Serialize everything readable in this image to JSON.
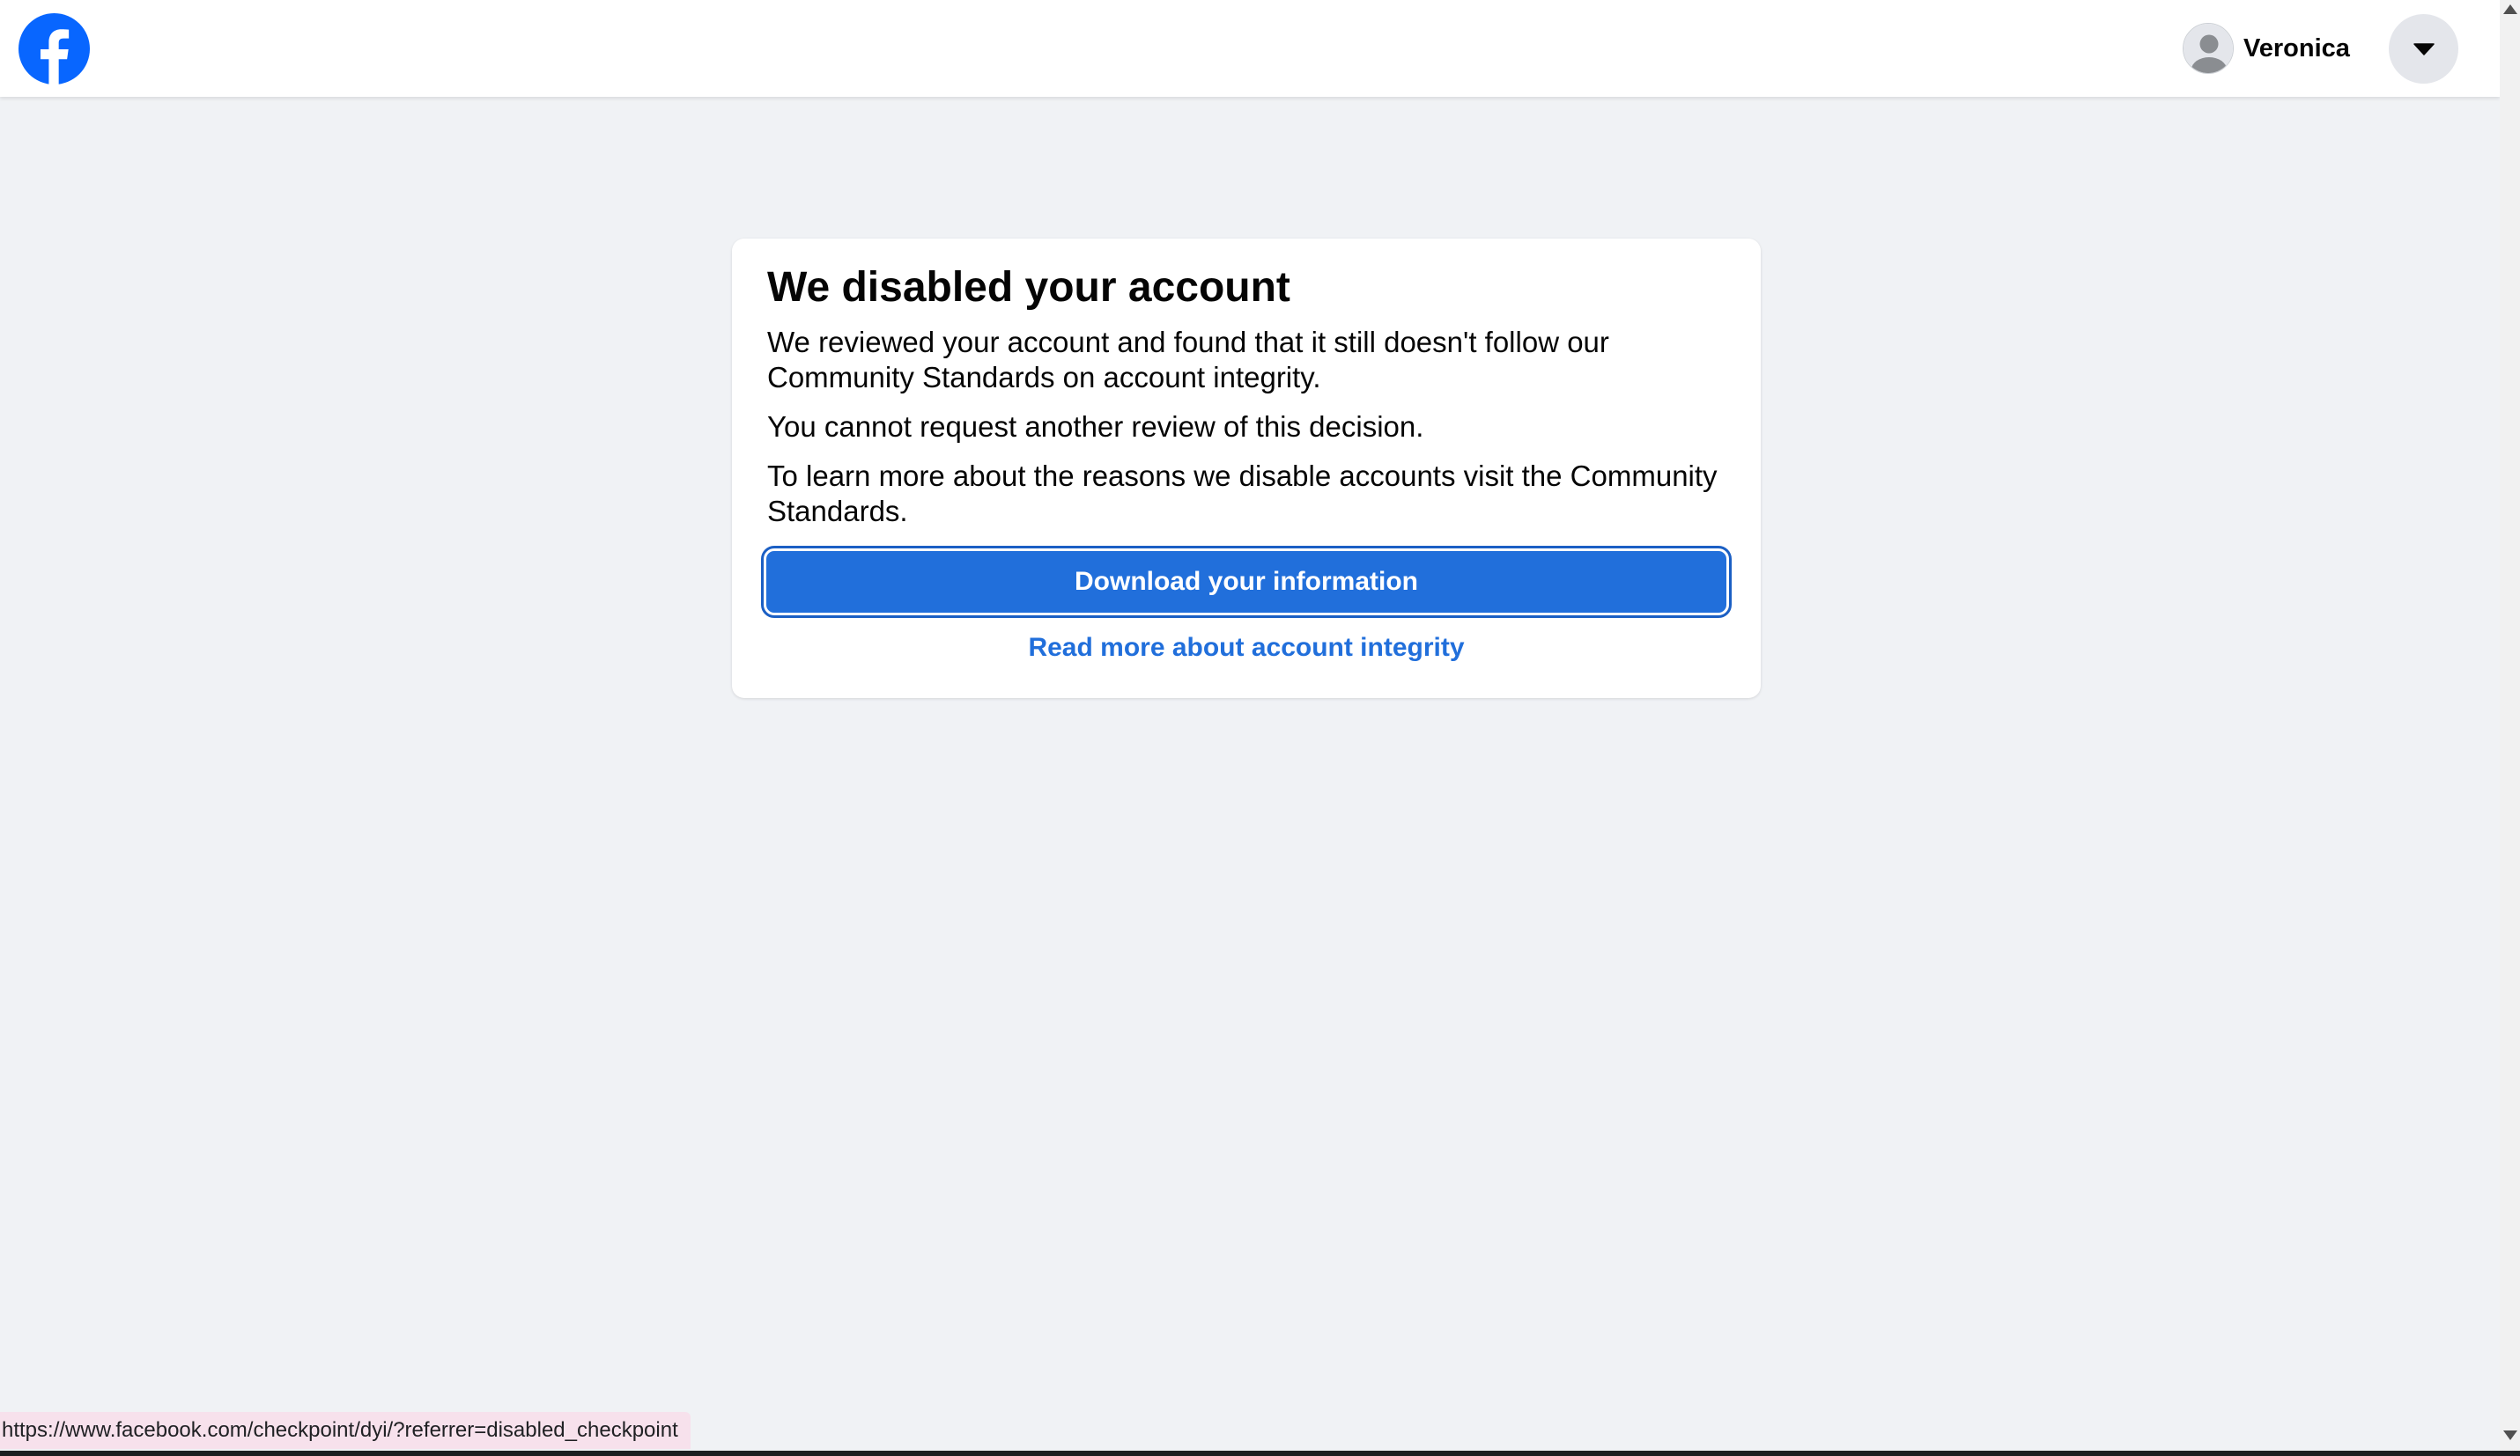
{
  "brand": {
    "logo_icon": "facebook-logo-icon",
    "accent_color": "#0866ff"
  },
  "header": {
    "user_name": "Veronica",
    "avatar_icon": "default-avatar-icon",
    "menu_icon": "caret-down-icon"
  },
  "card": {
    "title": "We disabled your account",
    "paragraphs": [
      "We reviewed your account and found that it still doesn't follow our Community Standards on account integrity.",
      "You cannot request another review of this decision.",
      "To learn more about the reasons we disable accounts visit the Community Standards."
    ],
    "primary_button_label": "Download your information",
    "link_label": "Read more about account integrity",
    "button_color": "#216fdb"
  },
  "status_bar": {
    "url": "https://www.facebook.com/checkpoint/dyi/?referrer=disabled_checkpoint"
  }
}
